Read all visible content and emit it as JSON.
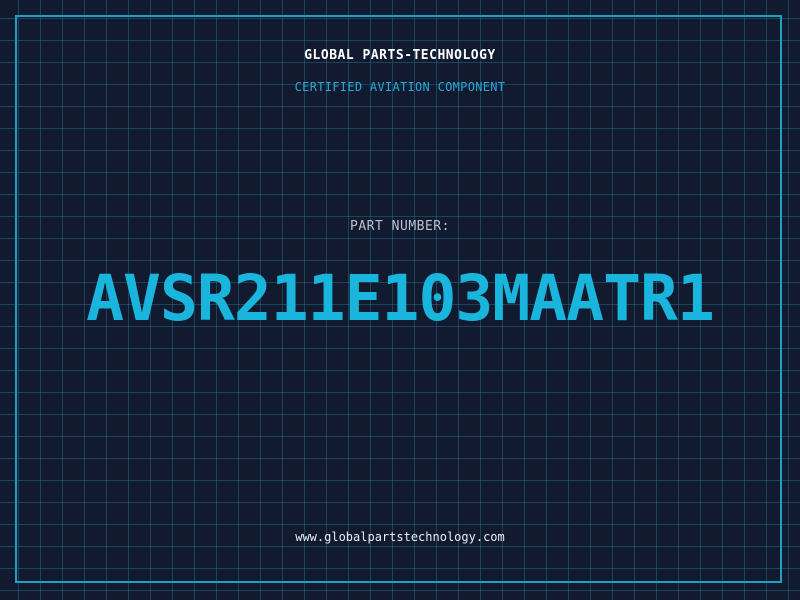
{
  "header": {
    "company": "GLOBAL PARTS-TECHNOLOGY",
    "subtitle": "CERTIFIED AVIATION COMPONENT"
  },
  "main": {
    "label": "PART NUMBER:",
    "part_number": "AVSR211E103MAATR1"
  },
  "footer": {
    "website": "www.globalpartstechnology.com"
  },
  "colors": {
    "background": "#111a2e",
    "grid": "#1e5f78",
    "frame": "#1f9fc4",
    "accent": "#19b5dc"
  }
}
